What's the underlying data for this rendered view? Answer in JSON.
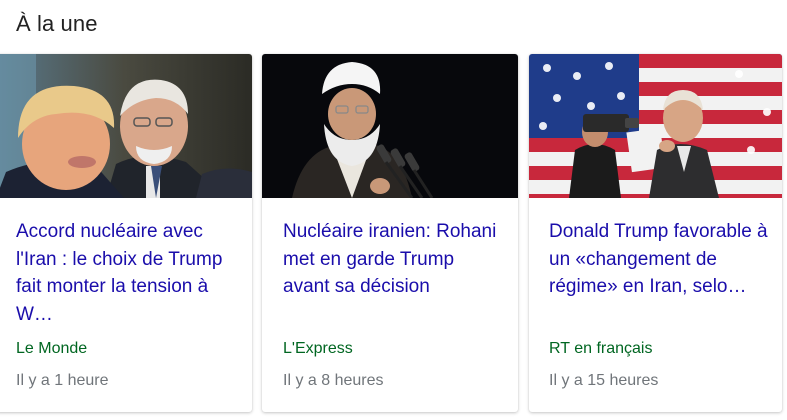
{
  "section": {
    "title": "À la une"
  },
  "cards": [
    {
      "image": "trump-bolton-photo",
      "headline": "Accord nucléaire avec l'Iran : le choix de Trump fait monter la tension à W…",
      "source": "Le Monde",
      "time": "Il y a 1 heure"
    },
    {
      "image": "rohani-photo",
      "headline": "Nucléaire iranien: Rohani met en garde Trump avant sa décision",
      "source": "L'Express",
      "time": "Il y a 8 heures"
    },
    {
      "image": "giuliani-flag-photo",
      "headline": "Donald Trump favorable à un «changement de régime» en Iran, selo…",
      "source": "RT en français",
      "time": "Il y a 15 heures"
    }
  ],
  "colors": {
    "headline": "#1a0dab",
    "source": "#006621",
    "time": "#70757a"
  }
}
